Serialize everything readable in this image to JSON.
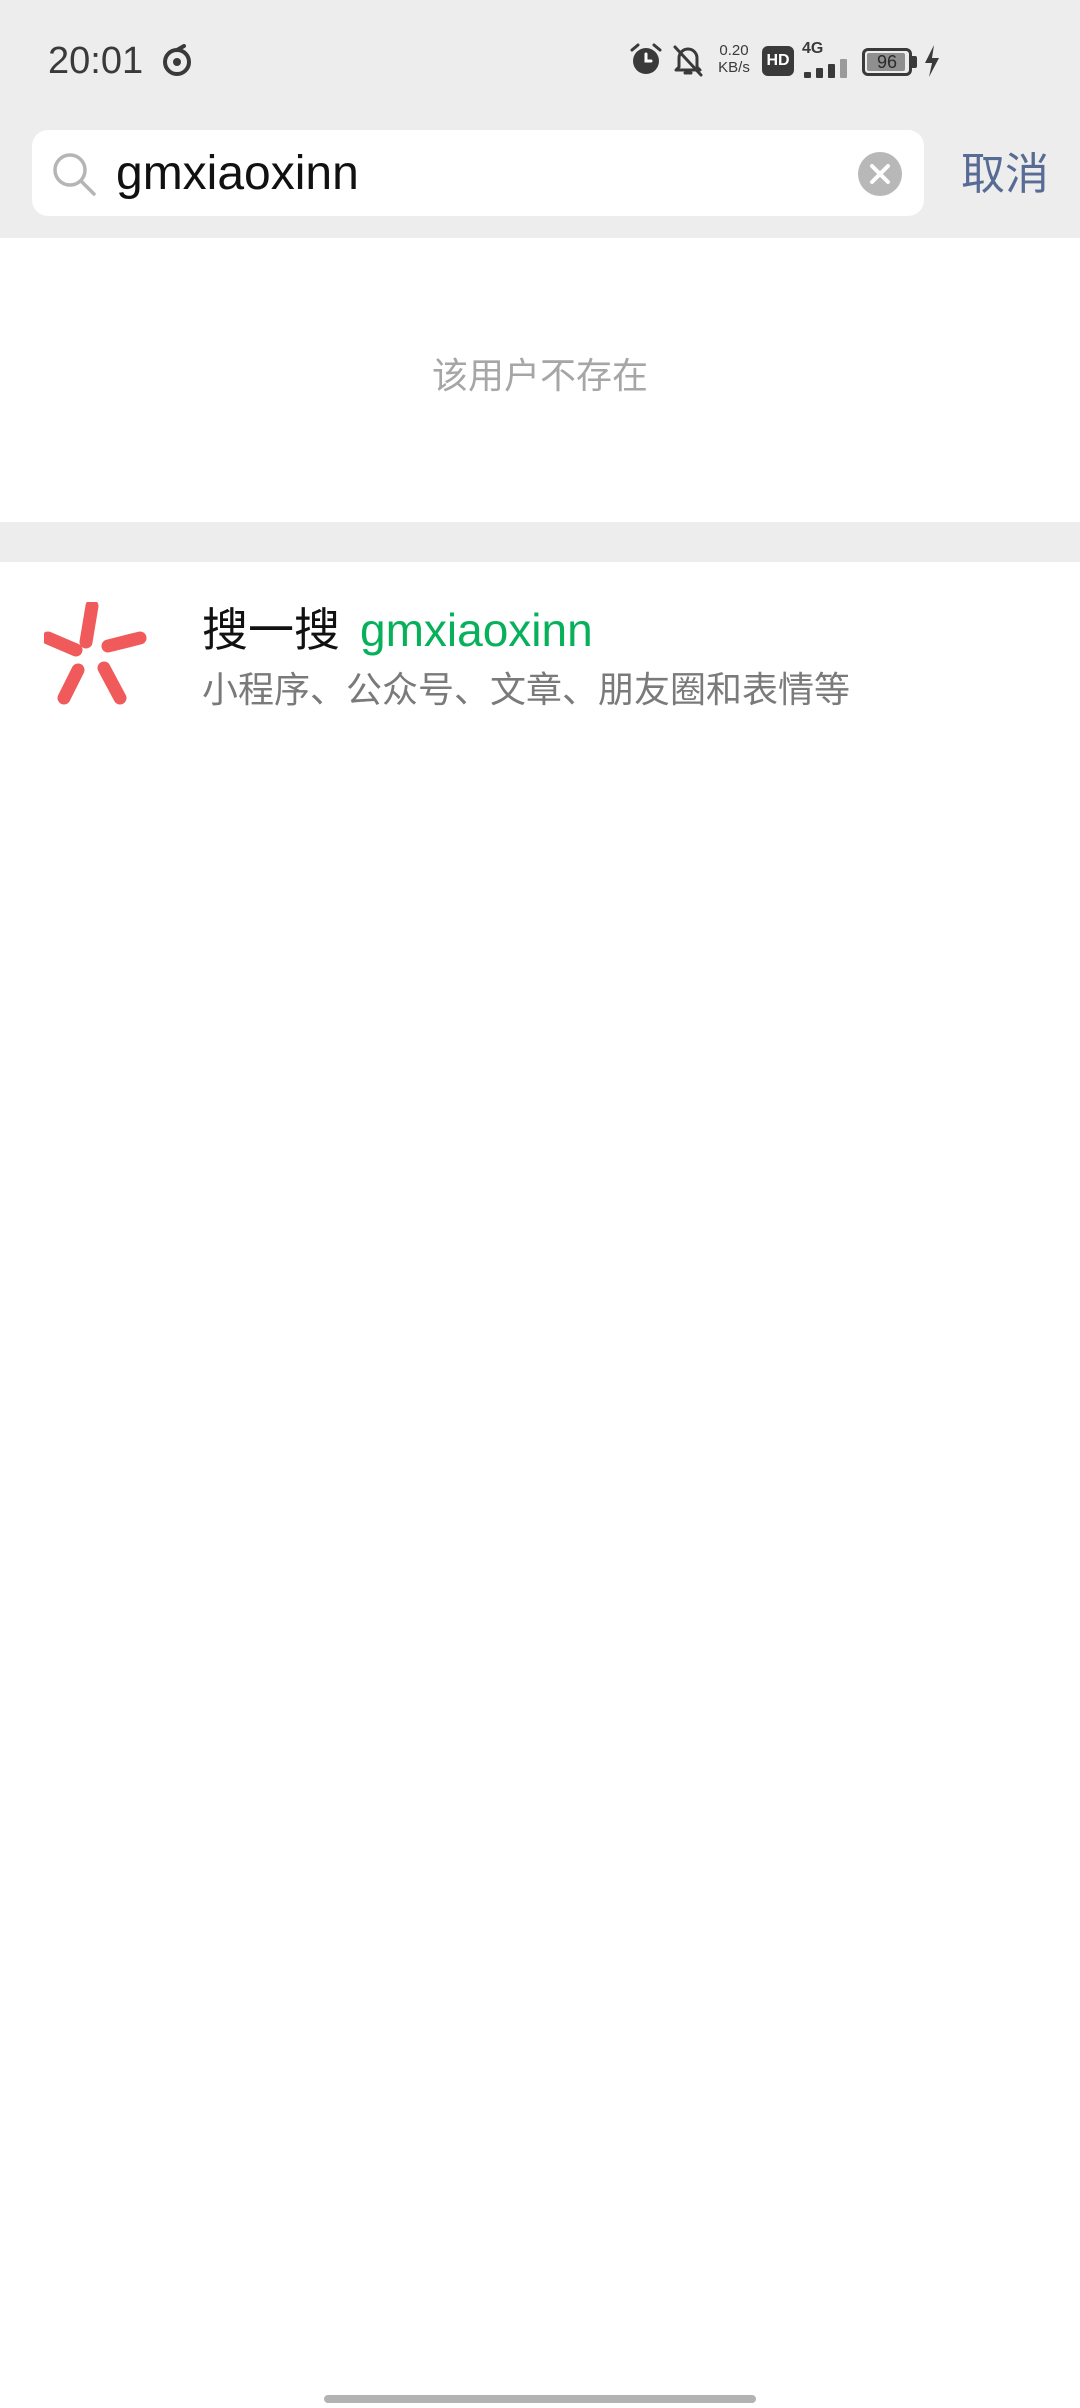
{
  "status_bar": {
    "time": "20:01",
    "speed_value": "0.20",
    "speed_unit": "KB/s",
    "hd_label": "HD",
    "network_label": "4G",
    "battery_level": "96",
    "icons": [
      "app-sync-icon",
      "alarm-icon",
      "mute-bell-icon",
      "hd-icon",
      "signal-icon",
      "battery-icon",
      "charging-icon"
    ]
  },
  "search": {
    "query": "gmxiaoxinn",
    "cancel_label": "取消"
  },
  "result": {
    "not_found_message": "该用户不存在"
  },
  "search_one_search": {
    "title": "搜一搜",
    "query": "gmxiaoxinn",
    "subtitle": "小程序、公众号、文章、朋友圈和表情等",
    "icon": "sou-yi-sou-icon",
    "icon_color": "#f05a5a",
    "query_color": "#07b05a"
  },
  "colors": {
    "header_bg": "#ededed",
    "cancel_link": "#576b95",
    "muted_text": "#a6a6a6"
  }
}
